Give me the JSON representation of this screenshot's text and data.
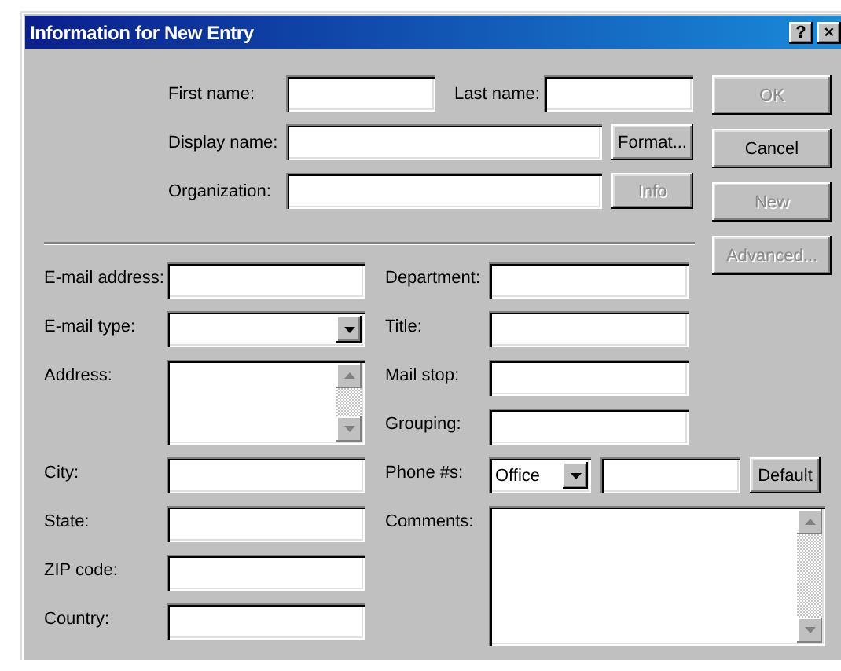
{
  "window": {
    "title": "Information for New Entry",
    "title_buttons": [
      {
        "kind": "help",
        "label": "?"
      },
      {
        "kind": "close",
        "label": "×"
      }
    ]
  },
  "header_rows": [
    {
      "fields": [
        {
          "label": "First name:"
        },
        {
          "label": "Last name:"
        }
      ]
    },
    {
      "fields": [
        {
          "label": "Display name:"
        }
      ],
      "button": {
        "label": "Format...",
        "disabled": false
      }
    },
    {
      "fields": [
        {
          "label": "Organization:"
        }
      ],
      "button": {
        "label": "Info",
        "disabled": true
      }
    }
  ],
  "buttons": [
    {
      "label": "OK",
      "disabled": true
    },
    {
      "label": "Cancel",
      "disabled": false
    },
    {
      "label": "New",
      "disabled": true
    },
    {
      "label": "Advanced...",
      "disabled": true
    }
  ],
  "left_fields": [
    {
      "label": "E-mail address:",
      "kind": "text"
    },
    {
      "label": "E-mail type:",
      "kind": "dropdown"
    },
    {
      "label": "Address:",
      "kind": "textarea"
    },
    {
      "label": "City:",
      "kind": "text"
    },
    {
      "label": "State:",
      "kind": "text"
    },
    {
      "label": "ZIP code:",
      "kind": "text"
    },
    {
      "label": "Country:",
      "kind": "text"
    }
  ],
  "right_fields": [
    {
      "label": "Department:",
      "kind": "text"
    },
    {
      "label": "Title:",
      "kind": "text"
    },
    {
      "label": "Mail stop:",
      "kind": "text"
    },
    {
      "label": "Grouping:",
      "kind": "text"
    },
    {
      "label": "Phone #s:",
      "kind": "phone",
      "value": "Office",
      "button": {
        "label": "Default",
        "disabled": false
      }
    },
    {
      "label": "Comments:",
      "kind": "textarea"
    }
  ]
}
